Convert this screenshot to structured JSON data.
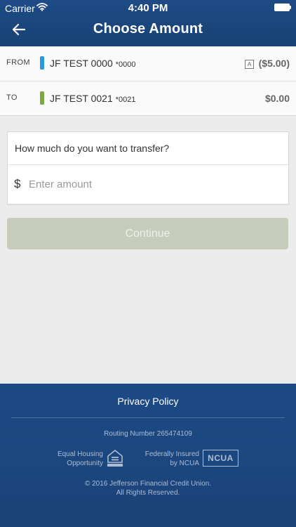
{
  "status_bar": {
    "carrier": "Carrier",
    "time": "4:40 PM",
    "wifi_icon": "wifi-icon",
    "battery_icon": "battery-icon"
  },
  "nav": {
    "title": "Choose Amount",
    "back_icon": "arrow-left-icon"
  },
  "accounts": {
    "from": {
      "label": "FROM",
      "name": "JF TEST 0000",
      "number": "*0000",
      "badge": "A",
      "amount": "($5.00)",
      "color": "#2a9ad8"
    },
    "to": {
      "label": "TO",
      "name": "JF TEST 0021",
      "number": "*0021",
      "amount": "$0.00",
      "color": "#7aa843"
    }
  },
  "amount_form": {
    "question": "How much do you want to transfer?",
    "currency_symbol": "$",
    "placeholder": "Enter amount",
    "value": ""
  },
  "continue_button": {
    "label": "Continue"
  },
  "footer": {
    "privacy_link": "Privacy Policy",
    "routing": "Routing Number 265474109",
    "ehl_line1": "Equal Housing",
    "ehl_line2": "Opportunity",
    "ehl_icon": "equal-housing-lender-icon",
    "ncua_line1": "Federally Insured",
    "ncua_line2": "by NCUA",
    "ncua_logo": "NCUA",
    "copyright_line1": "© 2016 Jefferson Financial Credit Union.",
    "copyright_line2": "All Rights Reserved."
  },
  "colors": {
    "header_blue": "#1e4b86",
    "footer_blue": "#1d4a85",
    "background": "#ececec",
    "continue_disabled": "#c7cdbc"
  }
}
